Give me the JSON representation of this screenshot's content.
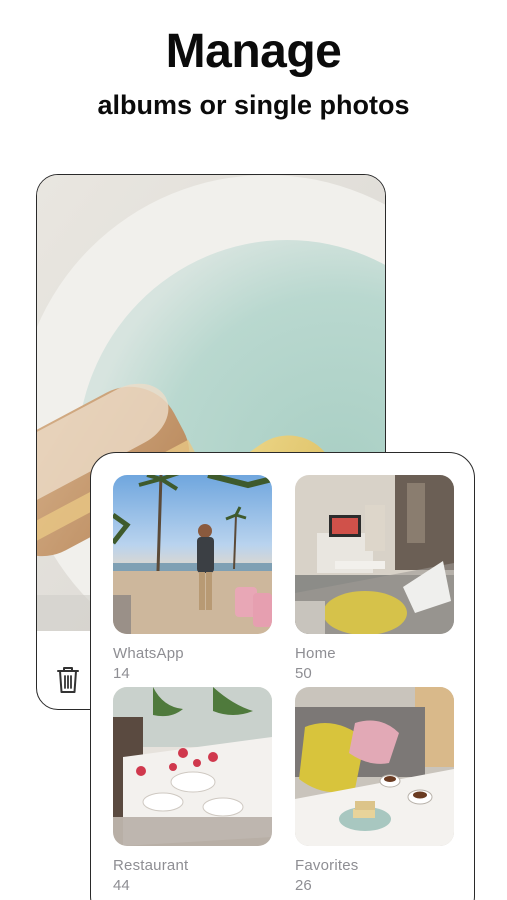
{
  "header": {
    "title": "Manage",
    "subtitle": "albums or single photos"
  },
  "photo_viewer": {
    "photo": "food-photo",
    "actions": {
      "delete_icon": "trash-icon"
    }
  },
  "albums": [
    {
      "name": "WhatsApp",
      "count": "14",
      "thumbnail": "beach-photo"
    },
    {
      "name": "Home",
      "count": "50",
      "thumbnail": "living-room-photo"
    },
    {
      "name": "Restaurant",
      "count": "44",
      "thumbnail": "restaurant-table-photo"
    },
    {
      "name": "Favorites",
      "count": "26",
      "thumbnail": "coffee-table-photo"
    }
  ],
  "colors": {
    "text_primary": "#0b0b0b",
    "text_secondary": "#8e8e93",
    "card_border": "#2a2a2a"
  }
}
